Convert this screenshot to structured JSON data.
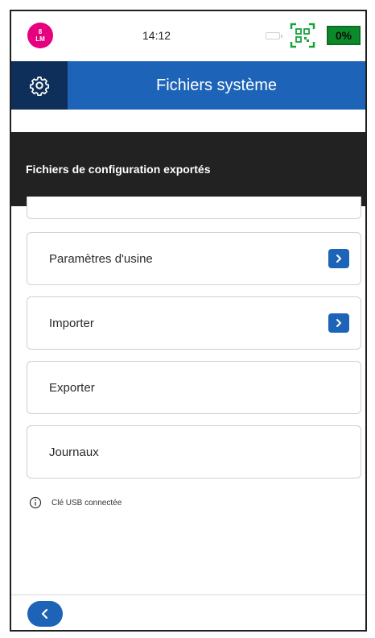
{
  "status_bar": {
    "avatar_text_top": "8",
    "avatar_text_bottom": "LM",
    "time": "14:12",
    "battery_level": "0%",
    "accent_colors": {
      "avatar": "#e6007e",
      "battery": "#0c8a2b",
      "qr": "#14a33c"
    }
  },
  "header": {
    "title": "Fichiers système",
    "settings_icon": "gear-icon",
    "colors": {
      "title_bar": "#1d63b8",
      "settings_box": "#0f2f5b"
    }
  },
  "banner": {
    "text": "Fichiers de configuration exportés"
  },
  "list": {
    "items": [
      {
        "label": "Paramètres d'usine",
        "has_chevron": true
      },
      {
        "label": "Importer",
        "has_chevron": true
      },
      {
        "label": "Exporter",
        "has_chevron": false
      },
      {
        "label": "Journaux",
        "has_chevron": false
      }
    ]
  },
  "usb": {
    "icon": "info-icon",
    "text": "Clé USB connectée"
  },
  "footer": {
    "back_icon": "chevron-left-icon"
  }
}
